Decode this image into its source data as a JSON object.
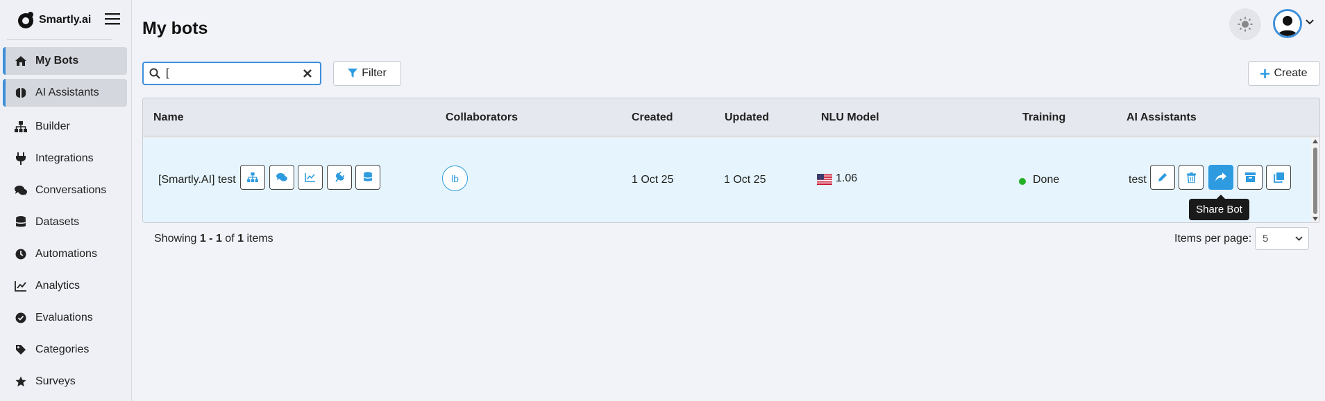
{
  "brand": {
    "name": "Smartly.ai"
  },
  "sidebar": {
    "items": [
      {
        "label": "My Bots",
        "icon": "home-icon"
      },
      {
        "label": "AI Assistants",
        "icon": "brain-icon"
      },
      {
        "label": "Builder",
        "icon": "sitemap-icon"
      },
      {
        "label": "Integrations",
        "icon": "plug-icon"
      },
      {
        "label": "Conversations",
        "icon": "comments-icon"
      },
      {
        "label": "Datasets",
        "icon": "database-icon"
      },
      {
        "label": "Automations",
        "icon": "clock-icon"
      },
      {
        "label": "Analytics",
        "icon": "line-chart-icon"
      },
      {
        "label": "Evaluations",
        "icon": "check-circle-icon"
      },
      {
        "label": "Categories",
        "icon": "tag-icon"
      },
      {
        "label": "Surveys",
        "icon": "star-icon"
      }
    ]
  },
  "page": {
    "title": "My bots"
  },
  "search": {
    "value": "[",
    "placeholder": ""
  },
  "toolbar": {
    "filter_label": "Filter",
    "create_label": "Create"
  },
  "table": {
    "headers": {
      "name": "Name",
      "collaborators": "Collaborators",
      "created": "Created",
      "updated": "Updated",
      "nlu": "NLU Model",
      "training": "Training",
      "assistants": "AI Assistants"
    },
    "rows": [
      {
        "name": "[Smartly.AI] test",
        "collaborator_initials": "lb",
        "created": "1 Oct 25",
        "updated": "1 Oct 25",
        "nlu_version": "1.06",
        "nlu_flag": "us-flag-icon",
        "training_status": "Done",
        "assistant": "test"
      }
    ]
  },
  "tooltip": {
    "text": "Share Bot"
  },
  "pagination": {
    "prefix": "Showing",
    "range": "1 - 1",
    "of": "of",
    "total": "1",
    "suffix": "items",
    "per_page_label": "Items per page:",
    "per_page_value": "5"
  },
  "colors": {
    "accent": "#2e9be0",
    "status_done": "#22b026",
    "row_highlight": "#e6f5fd"
  }
}
